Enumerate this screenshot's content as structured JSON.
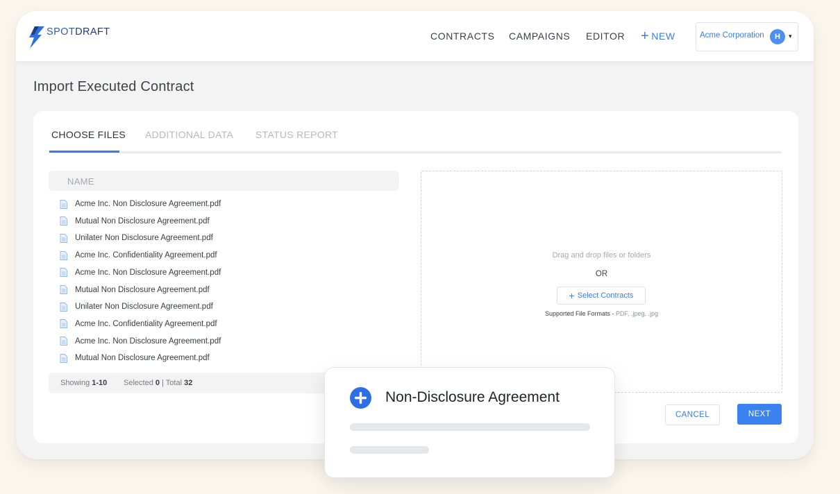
{
  "brand": {
    "part1": "SPOT",
    "part2": "DRAFT"
  },
  "nav": {
    "contracts": "CONTRACTS",
    "campaigns": "CAMPAIGNS",
    "editor": "EDITOR",
    "new_plus": "+",
    "new_label": "NEW"
  },
  "account": {
    "name": "Acme Corporation",
    "avatar_initial": "H",
    "caret": "▾"
  },
  "page_title": "Import Executed Contract",
  "tabs": [
    "CHOOSE FILES",
    "ADDITIONAL DATA",
    "STATUS REPORT"
  ],
  "active_tab": "CHOOSE FILES",
  "file_list": {
    "header": "NAME",
    "files": [
      "Acme Inc. Non Disclosure Agreement.pdf",
      "Mutual Non Disclosure Agreement.pdf",
      "Unilater Non Disclosure Agreement.pdf",
      "Acme Inc. Confidentiality Agreement.pdf",
      "Acme Inc. Non Disclosure Agreement.pdf",
      "Mutual Non Disclosure Agreement.pdf",
      "Unilater Non Disclosure Agreement.pdf",
      "Acme Inc. Confidentiality Agreement.pdf",
      "Acme Inc. Non Disclosure Agreement.pdf",
      "Mutual Non Disclosure Agreement.pdf"
    ],
    "footer": {
      "showing_label": "Showing",
      "showing_value": "1-10",
      "selected_label": "Selected",
      "selected_value": "0",
      "separator": "|",
      "total_label": "Total",
      "total_value": "32"
    }
  },
  "dropzone": {
    "hint": "Drag and drop files or folders",
    "or": "OR",
    "select_plus": "+",
    "select_label": "Select Contracts",
    "formats_label": "Supported File Formats -",
    "formats_value": "PDF, .jpeg, .jpg"
  },
  "buttons": {
    "cancel": "CANCEL",
    "next": "NEXT"
  },
  "popup": {
    "title": "Non-Disclosure Agreement"
  },
  "colors": {
    "accent": "#3b7be8",
    "primary_button": "#3b82f0",
    "page_bg": "#fbf7ef",
    "popup_icon": "#2f6fe6"
  },
  "icons": {
    "logo": "lightning-bolt-icon",
    "file": "document-icon",
    "popup": "plus-circle-icon"
  }
}
